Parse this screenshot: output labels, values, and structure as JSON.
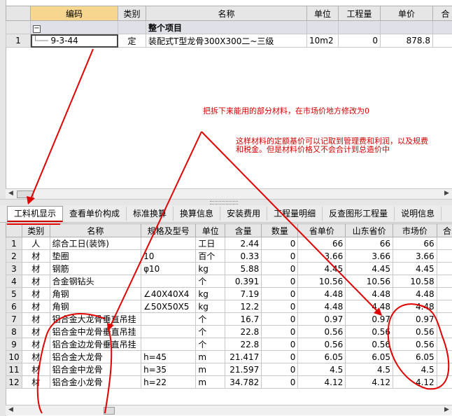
{
  "upper_grid": {
    "columns": [
      "编码",
      "类别",
      "名称",
      "单位",
      "工程量",
      "单价",
      "合"
    ],
    "group_row": {
      "expander": "−",
      "label": "整个项目"
    },
    "rows": [
      {
        "num": "1",
        "code": "9-3-44",
        "type": "定",
        "name": "装配式T型龙骨300X300二~三级",
        "unit": "10m2",
        "qty": "0",
        "price": "878.8"
      }
    ]
  },
  "annotations": {
    "note1": "把拆下来能用的部分材料，在市场价地方修改为0",
    "note2_line1": "这样材料的定额基价可以记取到管理费和利润，以及规费",
    "note2_line2": "和税金。但是材料价格又不会合计到总造价中"
  },
  "scroll": {
    "left": "◀",
    "right": "▶"
  },
  "tabs": [
    "工料机显示",
    "查看单价构成",
    "标准换算",
    "换算信息",
    "安装费用",
    "工程量明细",
    "反查图形工程量",
    "说明信息"
  ],
  "lower_grid": {
    "columns": [
      "",
      "类别",
      "名称",
      "规格及型号",
      "单位",
      "含量",
      "数量",
      "省单价",
      "山东省价",
      "市场价",
      "合"
    ],
    "rows": [
      {
        "num": "1",
        "type": "人",
        "name": "综合工日(装饰)",
        "spec": "",
        "unit": "工日",
        "content": "2.44",
        "qty": "0",
        "prov": "66",
        "sd": "66",
        "market": "66"
      },
      {
        "num": "2",
        "type": "材",
        "name": "垫圈",
        "spec": "10",
        "unit": "百个",
        "content": "0.33",
        "qty": "0",
        "prov": "3.66",
        "sd": "3.66",
        "market": "3.66"
      },
      {
        "num": "3",
        "type": "材",
        "name": "钢筋",
        "spec": "φ10",
        "unit": "kg",
        "content": "5.88",
        "qty": "0",
        "prov": "4.45",
        "sd": "4.45",
        "market": "4.45"
      },
      {
        "num": "4",
        "type": "材",
        "name": "合金钢钻头",
        "spec": "",
        "unit": "个",
        "content": "0.391",
        "qty": "0",
        "prov": "10.56",
        "sd": "10.56",
        "market": "10.58"
      },
      {
        "num": "5",
        "type": "材",
        "name": "角钢",
        "spec": "∠40X40X4",
        "unit": "kg",
        "content": "7.19",
        "qty": "0",
        "prov": "4.48",
        "sd": "4.48",
        "market": "4.48"
      },
      {
        "num": "6",
        "type": "材",
        "name": "角钢",
        "spec": "∠50X50X5",
        "unit": "kg",
        "content": "12.2",
        "qty": "0",
        "prov": "4.48",
        "sd": "4.48",
        "market": "4.48"
      },
      {
        "num": "7",
        "type": "材",
        "name": "铝合金大龙骨垂直吊挂",
        "spec": "",
        "unit": "个",
        "content": "16.7",
        "qty": "0",
        "prov": "0.97",
        "sd": "0.97",
        "market": "0.97"
      },
      {
        "num": "8",
        "type": "材",
        "name": "铝合金中龙骨垂直吊挂",
        "spec": "",
        "unit": "个",
        "content": "22.8",
        "qty": "0",
        "prov": "0.56",
        "sd": "0.56",
        "market": "0.56"
      },
      {
        "num": "9",
        "type": "材",
        "name": "铝合金边龙骨垂直吊挂",
        "spec": "",
        "unit": "个",
        "content": "22.8",
        "qty": "0",
        "prov": "0.56",
        "sd": "0.56",
        "market": "0.56"
      },
      {
        "num": "10",
        "type": "材",
        "name": "铝合金大龙骨",
        "spec": "h=45",
        "unit": "m",
        "content": "21.417",
        "qty": "0",
        "prov": "6.05",
        "sd": "6.05",
        "market": "6.05"
      },
      {
        "num": "11",
        "type": "材",
        "name": "铝合金中龙骨",
        "spec": "h=35",
        "unit": "m",
        "content": "21.597",
        "qty": "0",
        "prov": "4.5",
        "sd": "4.5",
        "market": "4.5"
      },
      {
        "num": "12",
        "type": "材",
        "name": "铝合金小龙骨",
        "spec": "h=22",
        "unit": "m",
        "content": "34.782",
        "qty": "0",
        "prov": "4.12",
        "sd": "4.12",
        "market": "4.12"
      }
    ]
  },
  "colors": {
    "annotation": "#d40000",
    "active_header": "#f7d690",
    "header": "#e6e6e6"
  }
}
